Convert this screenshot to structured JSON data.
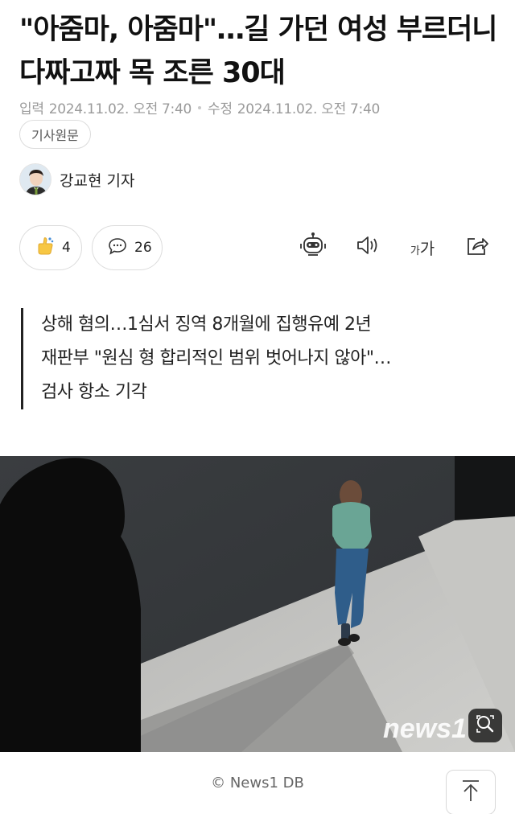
{
  "article": {
    "title": "\"아줌마, 아줌마\"…길 가던 여성 부르더니 다짜고짜 목 조른 30대",
    "meta": {
      "published_label": "입력",
      "published": "2024.11.02. 오전 7:40",
      "modified_label": "수정",
      "modified": "2024.11.02. 오전 7:40"
    },
    "source_button": "기사원문",
    "author": "강교현 기자",
    "summary": [
      "상해 혐의…1심서 징역 8개월에 집행유예 2년",
      "재판부 \"원심 형 합리적인 범위 벗어나지 않아\"…",
      "검사 항소 기각"
    ],
    "photo": {
      "watermark": "news1",
      "caption": "© News1 DB"
    }
  },
  "actions": {
    "like_count": "4",
    "comment_count": "26",
    "font_size_small": "가",
    "font_size_large": "가"
  },
  "icons": {
    "like": "thumbs-up-icon",
    "comment": "speech-bubble-icon",
    "summary": "robot-icon",
    "tts": "speaker-icon",
    "font": "font-size-icon",
    "share": "share-icon",
    "zoom": "magnify-icon",
    "top": "arrow-up-icon"
  }
}
